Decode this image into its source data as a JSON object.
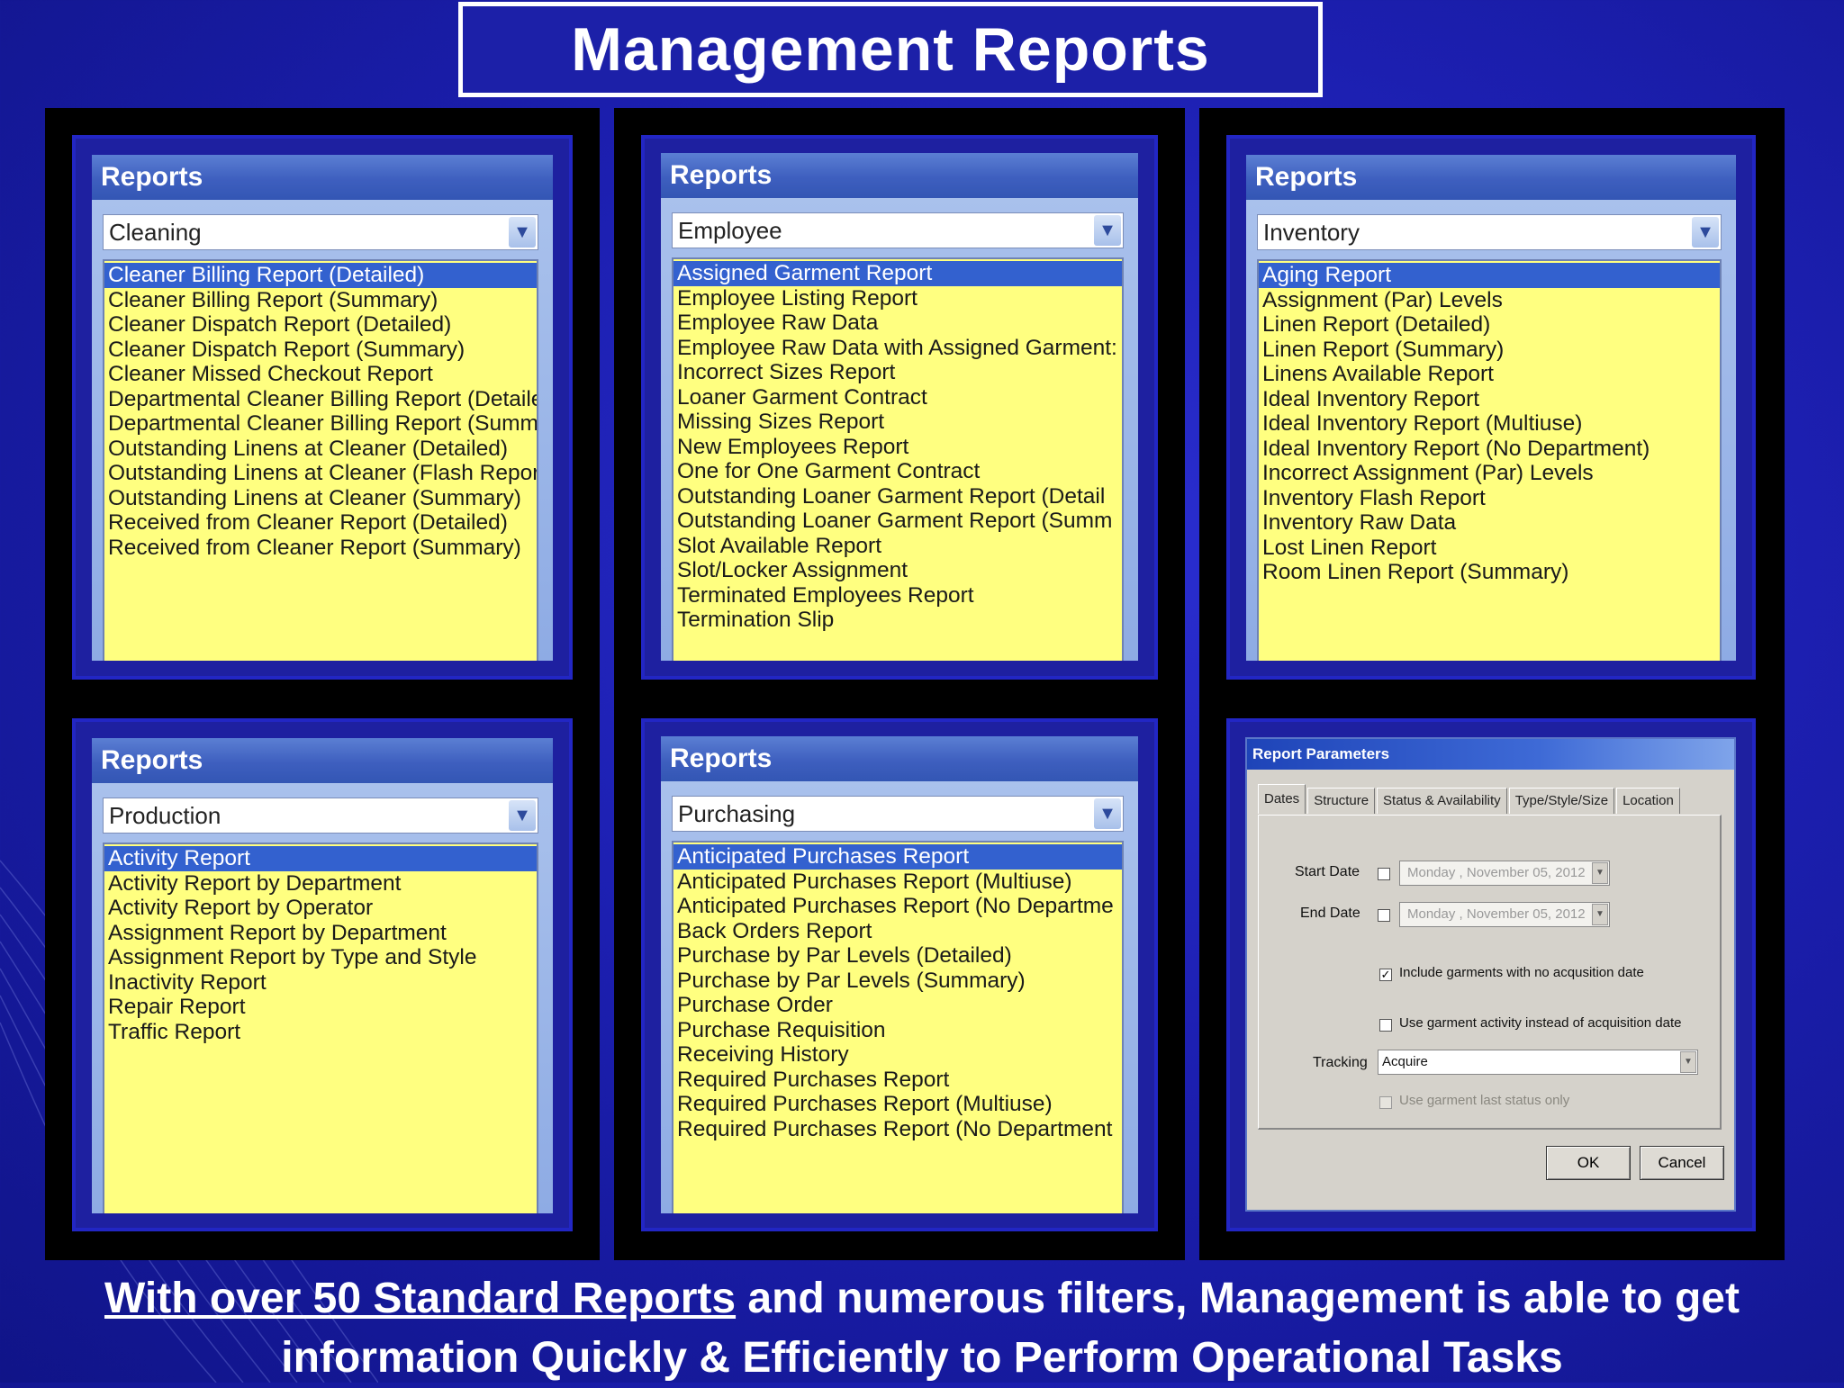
{
  "title": "Management Reports",
  "panels": [
    {
      "header": "Reports",
      "category": "Cleaning",
      "items": [
        "Cleaner Billing Report (Detailed)",
        "Cleaner Billing Report (Summary)",
        "Cleaner Dispatch Report (Detailed)",
        "Cleaner Dispatch Report (Summary)",
        "Cleaner Missed Checkout Report",
        "Departmental Cleaner Billing Report (Detaile",
        "Departmental Cleaner Billing Report (Summa",
        "Outstanding Linens at Cleaner (Detailed)",
        "Outstanding Linens at Cleaner (Flash Repor",
        "Outstanding Linens at Cleaner (Summary)",
        "Received from Cleaner Report (Detailed)",
        "Received from Cleaner Report (Summary)"
      ]
    },
    {
      "header": "Reports",
      "category": "Employee",
      "items": [
        "Assigned Garment Report",
        "Employee Listing Report",
        "Employee Raw Data",
        "Employee Raw Data with Assigned Garment:",
        "Incorrect Sizes Report",
        "Loaner Garment Contract",
        "Missing Sizes Report",
        "New Employees Report",
        "One for One Garment Contract",
        "Outstanding Loaner Garment Report (Detail",
        "Outstanding Loaner Garment Report (Summ",
        "Slot Available Report",
        "Slot/Locker Assignment",
        "Terminated Employees Report",
        "Termination Slip"
      ]
    },
    {
      "header": "Reports",
      "category": "Inventory",
      "items": [
        "Aging Report",
        "Assignment (Par) Levels",
        "Linen Report (Detailed)",
        "Linen Report (Summary)",
        "Linens Available Report",
        "Ideal Inventory Report",
        "Ideal Inventory Report (Multiuse)",
        "Ideal Inventory Report (No Department)",
        "Incorrect Assignment (Par) Levels",
        "Inventory Flash Report",
        "Inventory Raw Data",
        "Lost Linen Report",
        "Room Linen Report (Summary)"
      ]
    },
    {
      "header": "Reports",
      "category": "Production",
      "items": [
        "Activity Report",
        "Activity Report by Department",
        "Activity Report by Operator",
        "Assignment Report by Department",
        "Assignment Report by Type and Style",
        "Inactivity Report",
        "Repair Report",
        "Traffic Report"
      ]
    },
    {
      "header": "Reports",
      "category": "Purchasing",
      "items": [
        "Anticipated Purchases Report",
        "Anticipated Purchases Report (Multiuse)",
        "Anticipated Purchases Report (No Departme",
        "Back Orders Report",
        "Purchase by Par Levels (Detailed)",
        "Purchase by Par Levels (Summary)",
        "Purchase Order",
        "Purchase Requisition",
        "Receiving History",
        "Required Purchases Report",
        "Required Purchases Report (Multiuse)",
        "Required Purchases Report (No Department"
      ]
    }
  ],
  "dialog": {
    "title": "Report Parameters",
    "tabs": [
      "Dates",
      "Structure",
      "Status & Availability",
      "Type/Style/Size",
      "Location"
    ],
    "start_label": "Start Date",
    "end_label": "End Date",
    "start_date": "Monday    , November 05, 2012",
    "end_date": "Monday    , November 05, 2012",
    "include_label": "Include garments with no acqusition date",
    "use_activity_label": "Use garment activity instead of acquisition date",
    "tracking_label": "Tracking",
    "tracking_value": "Acquire",
    "last_status_label": "Use garment last status only",
    "ok": "OK",
    "cancel": "Cancel"
  },
  "footer": {
    "underlined": "With over 50 Standard Reports",
    "line1_rest": " and numerous filters, Management is able to get",
    "line2": "information Quickly & Efficiently to Perform Operational Tasks"
  }
}
